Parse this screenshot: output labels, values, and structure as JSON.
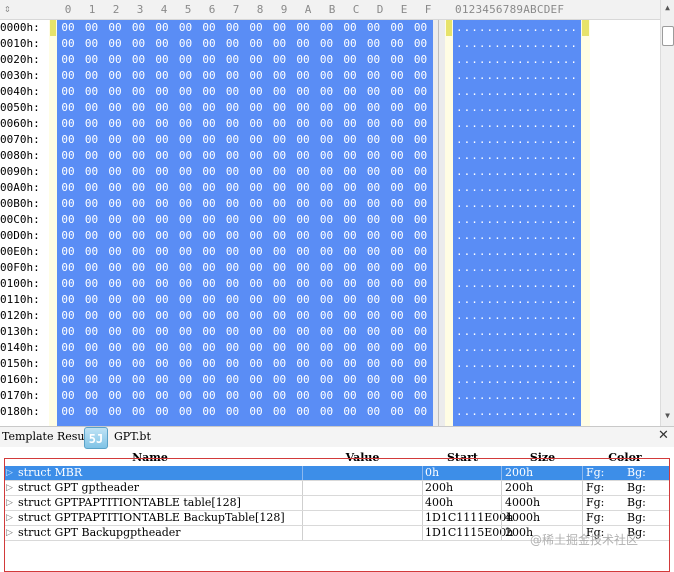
{
  "hex_editor": {
    "sort_icon": "sort-arrow-icon",
    "columns": [
      "0",
      "1",
      "2",
      "3",
      "4",
      "5",
      "6",
      "7",
      "8",
      "9",
      "A",
      "B",
      "C",
      "D",
      "E",
      "F"
    ],
    "ascii_header": "0123456789ABCDEF",
    "offsets": [
      "0000h:",
      "0010h:",
      "0020h:",
      "0030h:",
      "0040h:",
      "0050h:",
      "0060h:",
      "0070h:",
      "0080h:",
      "0090h:",
      "00A0h:",
      "00B0h:",
      "00C0h:",
      "00D0h:",
      "00E0h:",
      "00F0h:",
      "0100h:",
      "0110h:",
      "0120h:",
      "0130h:",
      "0140h:",
      "0150h:",
      "0160h:",
      "0170h:",
      "0180h:"
    ],
    "byte_value": "00",
    "ascii_row": "................",
    "selection_color": "#5a8df5"
  },
  "template_panel": {
    "title": "Template Resul",
    "file": "GPT.bt",
    "icon_glyph": "5J",
    "close_label": "✕",
    "columns": {
      "name": "Name",
      "value": "Value",
      "start": "Start",
      "size": "Size",
      "color": "Color"
    },
    "rows": [
      {
        "name": "struct MBR",
        "value": "",
        "start": "0h",
        "size": "200h",
        "fg": "Fg:",
        "bg": "Bg:",
        "selected": true
      },
      {
        "name": "struct GPT gptheader",
        "value": "",
        "start": "200h",
        "size": "200h",
        "fg": "Fg:",
        "bg": "Bg:",
        "selected": false
      },
      {
        "name": "struct GPTPAPTITIONTABLE table[128]",
        "value": "",
        "start": "400h",
        "size": "4000h",
        "fg": "Fg:",
        "bg": "Bg:",
        "selected": false
      },
      {
        "name": "struct GPTPAPTITIONTABLE BackupTable[128]",
        "value": "",
        "start": "1D1C1111E00h",
        "size": "4000h",
        "fg": "Fg:",
        "bg": "Bg:",
        "selected": false
      },
      {
        "name": "struct GPT Backupgptheader",
        "value": "",
        "start": "1D1C1115E00h",
        "size": "200h",
        "fg": "Fg:",
        "bg": "Bg:",
        "selected": false
      }
    ]
  },
  "watermark": "@稀土掘金技术社区"
}
